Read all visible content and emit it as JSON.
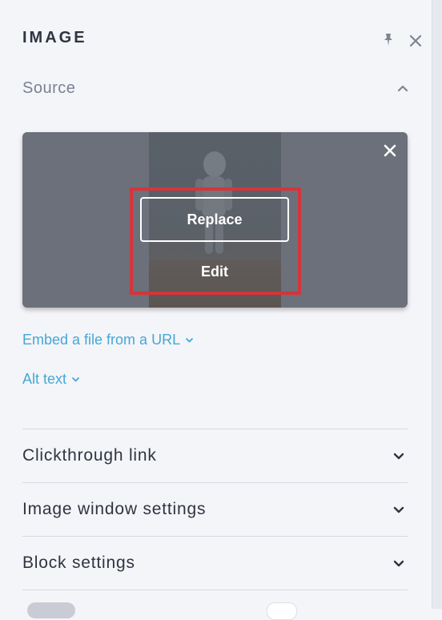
{
  "panel": {
    "title": "IMAGE"
  },
  "source": {
    "label": "Source",
    "replace_label": "Replace",
    "edit_label": "Edit"
  },
  "links": {
    "embed_label": "Embed a file from a URL",
    "alt_label": "Alt text"
  },
  "sections": [
    {
      "label": "Clickthrough link"
    },
    {
      "label": "Image window settings"
    },
    {
      "label": "Block settings"
    }
  ],
  "colors": {
    "accent_link": "#46a7d6",
    "highlight": "#d6343a",
    "text_primary": "#2f3440",
    "text_secondary": "#7a8191",
    "background": "#f4f5f9"
  },
  "icons": {
    "pin": "pin-icon",
    "close": "close-icon",
    "chevron_up": "chevron-up-icon",
    "chevron_down": "chevron-down-icon",
    "remove": "remove-image-icon"
  }
}
